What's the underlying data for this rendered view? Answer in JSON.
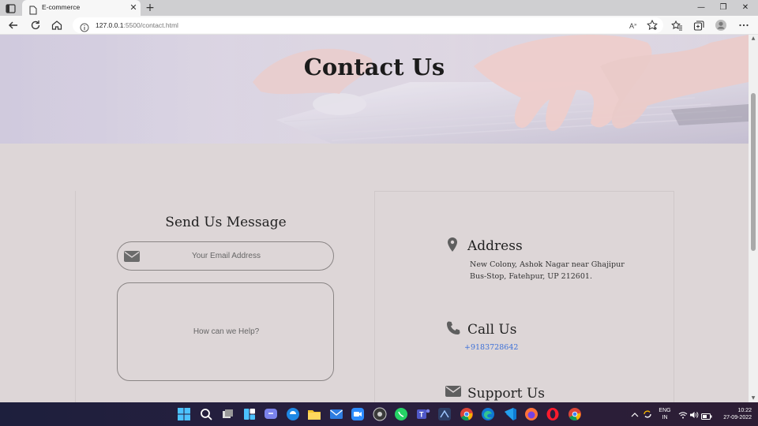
{
  "browser": {
    "tab_title": "E-commerce",
    "tab_close": "✕",
    "new_tab": "+",
    "url_host": "127.0.0.1",
    "url_rest": ":5500/contact.html",
    "win_minimize": "—",
    "win_restore": "❐",
    "win_close": "✕"
  },
  "hero": {
    "title": "Contact Us"
  },
  "form": {
    "title": "Send Us Message",
    "email_placeholder": "Your Email Address",
    "message_placeholder": "How can we Help?"
  },
  "info": {
    "address_heading": "Address",
    "address_line1": "New Colony, Ashok Nagar near Ghajipur",
    "address_line2": "Bus-Stop, Fatehpur, UP 212601.",
    "call_heading": "Call Us",
    "phone": "+9183728642",
    "support_heading": "Support Us"
  },
  "taskbar": {
    "lang_line1": "ENG",
    "lang_line2": "IN",
    "time": "10:22",
    "date": "27-09-2022"
  },
  "colors": {
    "page_bg": "#dcd6d8",
    "link": "#3b6fd8",
    "icon_grey": "#5f5f5f"
  }
}
